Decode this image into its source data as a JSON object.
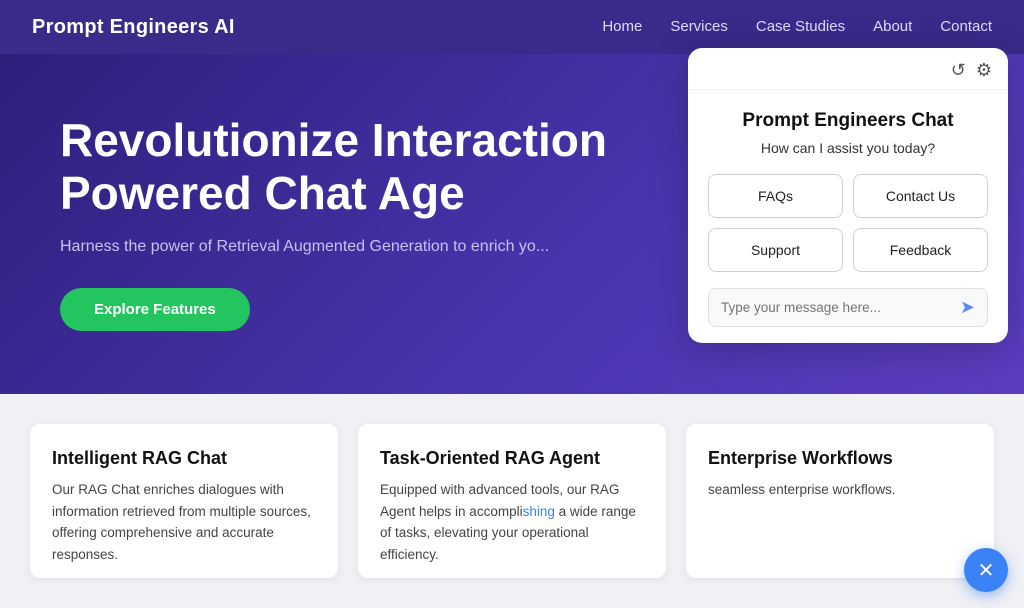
{
  "nav": {
    "logo": "Prompt Engineers AI",
    "links": [
      "Home",
      "Services",
      "Case Studies",
      "About",
      "Contact"
    ]
  },
  "hero": {
    "heading_line1": "Revolutionize Interaction",
    "heading_line2": "Powered Chat Age",
    "subtext": "Harness the power of Retrieval Augmented Generation to enrich yo...",
    "cta_label": "Explore Features"
  },
  "cards": [
    {
      "title": "Intelligent RAG Chat",
      "body": "Our RAG Chat enriches dialogues with information retrieved from multiple sources, offering comprehensive and accurate responses."
    },
    {
      "title": "Task-Oriented RAG Agent",
      "body": "Equipped with advanced tools, our RAG Agent helps in accomplishing a wide range of tasks, elevating your operational efficiency."
    },
    {
      "title": "Enterprise Workflows",
      "body": "seamless enterprise workflows."
    }
  ],
  "chat": {
    "title": "Prompt Engineers Chat",
    "subtitle": "How can I assist you today?",
    "buttons": [
      "FAQs",
      "Contact Us",
      "Support",
      "Feedback"
    ],
    "input_placeholder": "Type your message here...",
    "reset_icon": "↺",
    "settings_icon": "⚙",
    "send_icon": "➤",
    "close_icon": "✕"
  }
}
